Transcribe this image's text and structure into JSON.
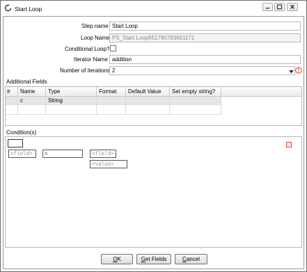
{
  "window": {
    "title": "Start Loop"
  },
  "form": {
    "step_name_label": "Step name",
    "step_name_value": "Start Loop",
    "loop_name_label": "Loop Name",
    "loop_name_value": "PS_Start Loop651790783661171",
    "conditional_loop_label": "Conditional Loop?",
    "conditional_loop_checked": false,
    "iterator_name_label": "Iterator Name",
    "iterator_name_value": "addition",
    "iterations_label": "Number of iterations",
    "iterations_value": "2"
  },
  "additional_fields": {
    "section_label": "Additional Fields",
    "columns": [
      "#",
      "Name",
      "Type",
      "Format",
      "Default Value",
      "Set empty string?"
    ],
    "rows": [
      {
        "num": "",
        "name": "c",
        "type": "String",
        "format": "",
        "default": "",
        "empty": ""
      }
    ]
  },
  "conditions": {
    "section_label": "Condition(s)",
    "left_field": "<field>",
    "operator": "=",
    "right_field": "<field>",
    "value": "<value>"
  },
  "buttons": {
    "ok_prefix": "",
    "ok_mnemonic": "O",
    "ok_rest": "K",
    "get_fields_mnemonic": "G",
    "get_fields_rest": "et Fields",
    "cancel_mnemonic": "C",
    "cancel_rest": "ancel"
  },
  "icons": {
    "app": "spinner-loop-icon",
    "warning": "warning-circle-icon",
    "delete": "delete-condition-icon"
  },
  "colors": {
    "accent_warning": "#d9532c",
    "border": "#b5b5b5"
  }
}
